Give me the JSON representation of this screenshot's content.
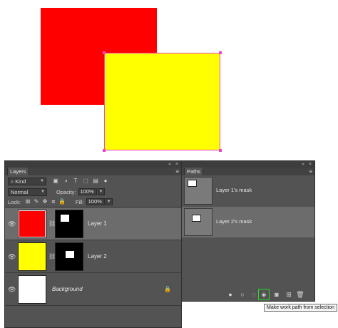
{
  "canvas": {
    "red_color": "#ff0000",
    "yellow_color": "#ffff00",
    "path_color": "#e846c8"
  },
  "layers_panel": {
    "tab_label": "Layers",
    "menu_icon": "panel-menu-icon",
    "filter_kind": "Kind",
    "blend_mode": "Normal",
    "opacity_label": "Opacity:",
    "opacity_value": "100%",
    "lock_label": "Lock:",
    "fill_label": "Fill:",
    "fill_value": "100%",
    "layers": [
      {
        "name": "Layer 1",
        "color": "#ff0000",
        "selected": true
      },
      {
        "name": "Layer 2",
        "color": "#ffff00",
        "selected": false
      },
      {
        "name": "Background",
        "color": "#ffffff",
        "selected": false
      }
    ]
  },
  "paths_panel": {
    "tab_label": "Paths",
    "menu_icon": "panel-menu-icon",
    "paths": [
      {
        "name": "Layer 1's mask"
      },
      {
        "name": "Layer 2's mask"
      }
    ],
    "footer_buttons": [
      "fill-path-icon",
      "stroke-path-icon",
      "load-selection-icon",
      "make-work-path-icon",
      "add-mask-icon",
      "new-path-icon",
      "trash-icon"
    ]
  },
  "tooltip": {
    "text": "Make work path from selection"
  }
}
